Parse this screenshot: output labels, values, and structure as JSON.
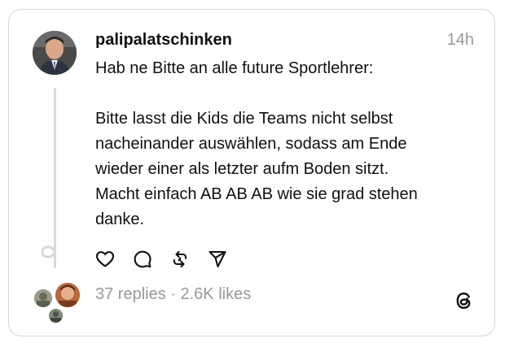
{
  "post": {
    "username": "palipalatschinken",
    "time": "14h",
    "text_lines_1": [
      "Hab ne Bitte an alle future Sportlehrer:"
    ],
    "text_lines_2": [
      "Bitte lasst die Kids die Teams nicht selbst",
      "nacheinander auswählen, sodass am Ende",
      "wieder einer als letzter aufm Boden sitzt.",
      "Macht einfach AB AB AB wie sie grad stehen",
      "danke."
    ]
  },
  "actions": {
    "icons": [
      "heart-icon",
      "comment-icon",
      "repost-icon",
      "share-icon"
    ]
  },
  "stats": {
    "text": "37 replies · 2.6K likes"
  },
  "brand": {
    "logo_icon": "threads-logo-icon"
  }
}
